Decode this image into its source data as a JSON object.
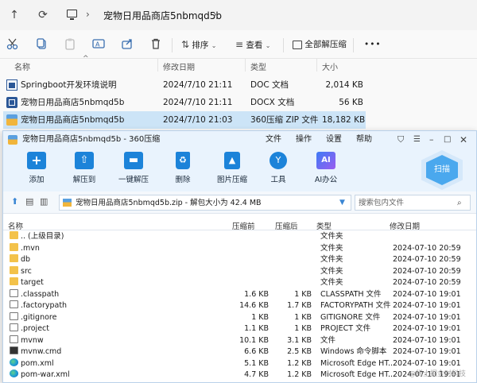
{
  "explorer": {
    "breadcrumb": [
      "宠物日用品商店5nbmqd5b"
    ],
    "toolbar": {
      "sort_label": "排序",
      "view_label": "查看",
      "extract_label": "全部解压缩",
      "more_label": "•••"
    },
    "columns": {
      "name": "名称",
      "date": "修改日期",
      "type": "类型",
      "size": "大小"
    },
    "files": [
      {
        "name": "Springboot开发环境说明",
        "date": "2024/7/10 21:11",
        "type": "DOC 文档",
        "size": "2,014 KB",
        "icon": "word-doc-icon"
      },
      {
        "name": "宠物日用品商店5nbmqd5b",
        "date": "2024/7/10 21:11",
        "type": "DOCX 文档",
        "size": "56 KB",
        "icon": "word-docx-icon"
      },
      {
        "name": "宠物日用品商店5nbmqd5b",
        "date": "2024/7/10 21:03",
        "type": "360压缩 ZIP 文件",
        "size": "18,182 KB",
        "icon": "zip-archive-icon",
        "selected": true
      }
    ]
  },
  "zip": {
    "title": "宠物日用品商店5nbmqd5b - 360压缩",
    "menu": [
      "文件",
      "操作",
      "设置",
      "帮助"
    ],
    "buttons": [
      {
        "label": "添加",
        "icon": "add-icon"
      },
      {
        "label": "解压到",
        "icon": "extract-to-icon"
      },
      {
        "label": "一键解压",
        "icon": "one-click-extract-icon"
      },
      {
        "label": "删除",
        "icon": "delete-icon"
      },
      {
        "label": "图片压缩",
        "icon": "image-compress-icon"
      },
      {
        "label": "工具",
        "icon": "tools-icon"
      },
      {
        "label": "AI办公",
        "icon": "ai-office-icon"
      }
    ],
    "scan_label": "扫描",
    "ai_badge": "AI",
    "path": "宠物日用品商店5nbmqd5b.zip - 解包大小为 42.4 MB",
    "search_placeholder": "搜索包内文件",
    "columns": {
      "name": "名称",
      "compressed": "压缩前",
      "packed": "压缩后",
      "type": "类型",
      "date": "修改日期"
    },
    "rows": [
      {
        "name": ".. (上级目录)",
        "before": "",
        "after": "",
        "type": "文件夹",
        "date": "",
        "kind": "folder"
      },
      {
        "name": ".mvn",
        "before": "",
        "after": "",
        "type": "文件夹",
        "date": "2024-07-10 20:59",
        "kind": "folder"
      },
      {
        "name": "db",
        "before": "",
        "after": "",
        "type": "文件夹",
        "date": "2024-07-10 20:59",
        "kind": "folder"
      },
      {
        "name": "src",
        "before": "",
        "after": "",
        "type": "文件夹",
        "date": "2024-07-10 20:59",
        "kind": "folder"
      },
      {
        "name": "target",
        "before": "",
        "after": "",
        "type": "文件夹",
        "date": "2024-07-10 20:59",
        "kind": "folder"
      },
      {
        "name": ".classpath",
        "before": "1.6 KB",
        "after": "1 KB",
        "type": "CLASSPATH 文件",
        "date": "2024-07-10 19:01",
        "kind": "doc"
      },
      {
        "name": ".factorypath",
        "before": "14.6 KB",
        "after": "1.7 KB",
        "type": "FACTORYPATH 文件",
        "date": "2024-07-10 19:01",
        "kind": "doc"
      },
      {
        "name": ".gitignore",
        "before": "1 KB",
        "after": "1 KB",
        "type": "GITIGNORE 文件",
        "date": "2024-07-10 19:01",
        "kind": "doc"
      },
      {
        "name": ".project",
        "before": "1.1 KB",
        "after": "1 KB",
        "type": "PROJECT 文件",
        "date": "2024-07-10 19:01",
        "kind": "doc"
      },
      {
        "name": "mvnw",
        "before": "10.1 KB",
        "after": "3.1 KB",
        "type": "文件",
        "date": "2024-07-10 19:01",
        "kind": "doc"
      },
      {
        "name": "mvnw.cmd",
        "before": "6.6 KB",
        "after": "2.5 KB",
        "type": "Windows 命令脚本",
        "date": "2024-07-10 19:01",
        "kind": "cmd"
      },
      {
        "name": "pom.xml",
        "before": "5.1 KB",
        "after": "1.2 KB",
        "type": "Microsoft Edge HT...",
        "date": "2024-07-10 19:01",
        "kind": "edge"
      },
      {
        "name": "pom-war.xml",
        "before": "4.7 KB",
        "after": "1.2 KB",
        "type": "Microsoft Edge HT...",
        "date": "2024-07-10 19:01",
        "kind": "edge"
      }
    ],
    "watermark": "@稀土掘金时科技"
  }
}
